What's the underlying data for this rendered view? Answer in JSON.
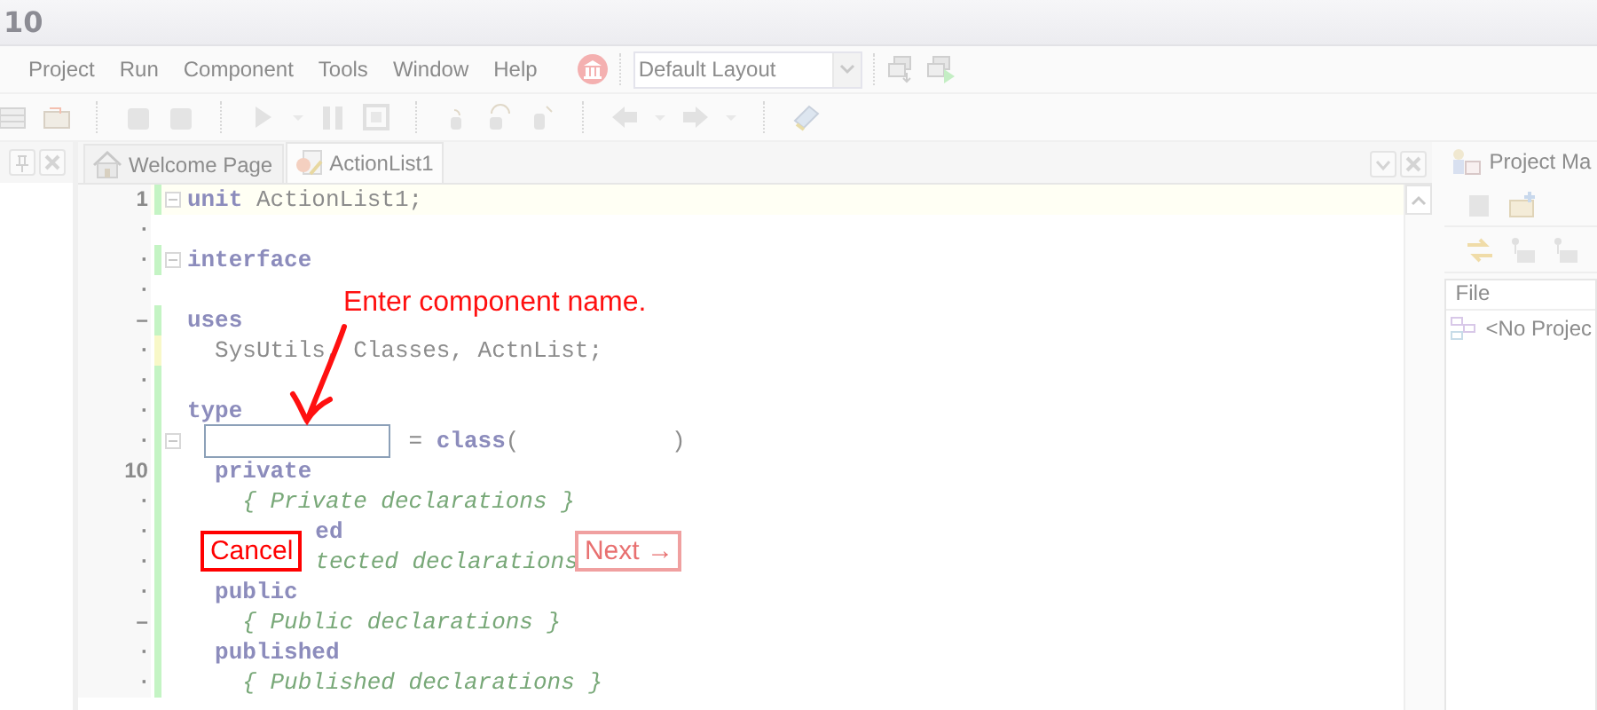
{
  "window": {
    "title": "10"
  },
  "menu": [
    {
      "label": "Project"
    },
    {
      "label": "Run"
    },
    {
      "label": "Component"
    },
    {
      "label": "Tools"
    },
    {
      "label": "Window"
    },
    {
      "label": "Help"
    }
  ],
  "layout_select": {
    "value": "Default Layout"
  },
  "editor": {
    "tabs": [
      {
        "label": "Welcome Page",
        "selected": false
      },
      {
        "label": "ActionList1",
        "selected": true
      }
    ],
    "lines": [
      {
        "gutter": "1",
        "fold": true,
        "current": true,
        "color": "#c4f4c4",
        "segments": [
          {
            "kind": "keyword",
            "text": "unit"
          },
          {
            "kind": "plain",
            "text": " ActionList1;"
          }
        ]
      },
      {
        "gutter": "·",
        "fold": false,
        "current": false
      },
      {
        "gutter": "·",
        "fold": true,
        "current": false,
        "color": "#c4f4c4",
        "segments": [
          {
            "kind": "keyword",
            "text": "interface"
          }
        ]
      },
      {
        "gutter": "·",
        "fold": false,
        "current": false
      },
      {
        "gutter": "–",
        "fold": false,
        "current": false,
        "color": "#c4f4c4",
        "segments": [
          {
            "kind": "keyword",
            "text": "uses"
          }
        ]
      },
      {
        "gutter": "·",
        "fold": false,
        "current": false,
        "color": "#f8f8c8",
        "segments": [
          {
            "kind": "plain",
            "text": "  SysUtils, Classes, ActnList;"
          }
        ]
      },
      {
        "gutter": "·",
        "fold": false,
        "current": false,
        "color": "#c4f4c4"
      },
      {
        "gutter": "·",
        "fold": false,
        "current": false,
        "color": "#c4f4c4",
        "segments": [
          {
            "kind": "keyword",
            "text": "type"
          }
        ]
      },
      {
        "gutter": "·",
        "fold": true,
        "current": false,
        "color": "#c4f4c4",
        "segments": [
          {
            "kind": "field"
          },
          {
            "kind": "plain",
            "text": " = "
          },
          {
            "kind": "keyword",
            "text": "class"
          },
          {
            "kind": "plain",
            "text": "(           )"
          }
        ]
      },
      {
        "gutter": "10",
        "fold": false,
        "current": false,
        "color": "#c4f4c4",
        "segments": [
          {
            "kind": "keyword",
            "text": "  private"
          }
        ]
      },
      {
        "gutter": "·",
        "fold": false,
        "current": false,
        "color": "#c4f4c4",
        "segments": [
          {
            "kind": "comment",
            "text": "    { Private declarations }"
          }
        ]
      },
      {
        "gutter": "·",
        "fold": false,
        "current": false,
        "color": "#c4f4c4",
        "segments": [
          {
            "kind": "spacer"
          },
          {
            "kind": "keyword",
            "text": "ed"
          }
        ]
      },
      {
        "gutter": "·",
        "fold": false,
        "current": false,
        "color": "#c4f4c4",
        "segments": [
          {
            "kind": "spacer"
          },
          {
            "kind": "comment",
            "text": "tected declarations"
          }
        ]
      },
      {
        "gutter": "·",
        "fold": false,
        "current": false,
        "color": "#c4f4c4",
        "segments": [
          {
            "kind": "keyword",
            "text": "  public"
          }
        ]
      },
      {
        "gutter": "–",
        "fold": false,
        "current": false,
        "color": "#c4f4c4",
        "segments": [
          {
            "kind": "comment",
            "text": "    { Public declarations }"
          }
        ]
      },
      {
        "gutter": "·",
        "fold": false,
        "current": false,
        "color": "#c4f4c4",
        "segments": [
          {
            "kind": "keyword",
            "text": "  published"
          }
        ]
      },
      {
        "gutter": "·",
        "fold": false,
        "current": false,
        "color": "#c4f4c4",
        "segments": [
          {
            "kind": "comment",
            "text": "    { Published declarations }"
          }
        ]
      }
    ]
  },
  "project_manager": {
    "title": "Project Ma",
    "column": "File",
    "items": [
      {
        "label": "<No Projec"
      }
    ]
  },
  "wizard": {
    "hint": "Enter component name.",
    "buttons": [
      {
        "label": "Cancel",
        "disabled": false
      },
      {
        "label": "Next →",
        "disabled": true
      }
    ]
  }
}
